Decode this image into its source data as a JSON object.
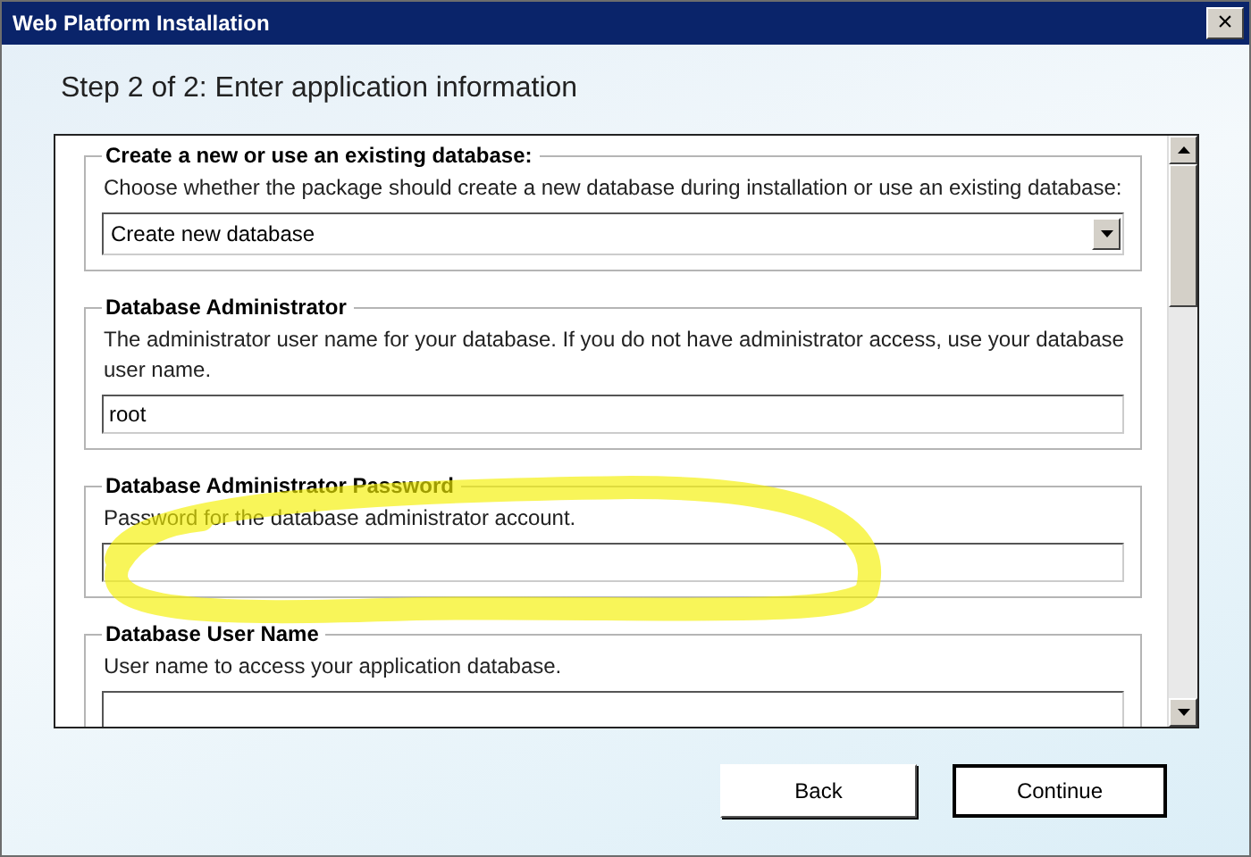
{
  "window": {
    "title": "Web Platform Installation",
    "close_glyph": "×"
  },
  "heading": "Step 2 of 2: Enter application information",
  "sections": [
    {
      "kind": "select",
      "legend": "Create a new or use an existing database:",
      "description": "Choose whether the package should create a new database during installation or use an existing database:",
      "value": "Create new database"
    },
    {
      "kind": "text",
      "legend": "Database Administrator",
      "description": "The administrator user name for your database. If you do not have administrator access, use your database user name.",
      "value": "root"
    },
    {
      "kind": "text",
      "legend": "Database Administrator Password",
      "description": "Password for the database administrator account."
    },
    {
      "kind": "text",
      "legend": "Database User Name",
      "description": "User name to access your application database."
    }
  ],
  "buttons": [
    {
      "label": "Back",
      "default": false
    },
    {
      "label": "Continue",
      "default": true
    }
  ]
}
